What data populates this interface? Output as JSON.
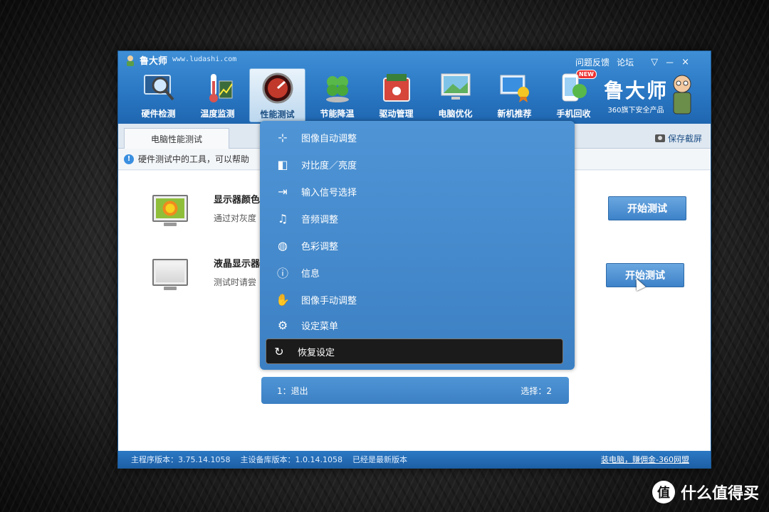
{
  "app": {
    "title": "鲁大师",
    "url": "www.ludashi.com",
    "top_links": [
      "问题反馈",
      "论坛"
    ],
    "window_controls": [
      "▽",
      "－",
      "×"
    ]
  },
  "toolbar": {
    "items": [
      {
        "label": "硬件检测",
        "icon": "magnifier-monitor-icon",
        "color": "#8fb8e0"
      },
      {
        "label": "温度监测",
        "icon": "thermometer-icon",
        "color": "#d9534f"
      },
      {
        "label": "性能测试",
        "icon": "speedometer-icon",
        "color": "#c0392b",
        "active": true
      },
      {
        "label": "节能降温",
        "icon": "clover-icon",
        "color": "#59b84a"
      },
      {
        "label": "驱动管理",
        "icon": "chip-box-icon",
        "color": "#d6463b"
      },
      {
        "label": "电脑优化",
        "icon": "monitor-landscape-icon",
        "color": "#5fb05f"
      },
      {
        "label": "新机推荐",
        "icon": "monitor-medal-icon",
        "color": "#3a8fe0"
      },
      {
        "label": "手机回收",
        "icon": "phone-recycle-icon",
        "color": "#59b84a",
        "badge": "NEW"
      }
    ]
  },
  "brand": {
    "name": "鲁大师",
    "subtitle": "360旗下安全产品"
  },
  "tabs": {
    "current": "电脑性能测试",
    "save_screenshot": "保存截屏"
  },
  "info_text": "硬件测试中的工具，可以帮助",
  "tests": [
    {
      "title": "显示器颜色",
      "desc": "通过对灰度",
      "button": "开始测试"
    },
    {
      "title": "液晶显示器",
      "desc": "测试时请尝",
      "button": "开始测试"
    }
  ],
  "status": {
    "main_version_label": "主程序版本：",
    "main_version": "3.75.14.1058",
    "db_version_label": "主设备库版本：",
    "db_version": "1.0.14.1058",
    "latest": "已经是最新版本",
    "promo_link": "装电脑，赚佣金-360网盟"
  },
  "osd": {
    "items": [
      {
        "label": "图像自动调整",
        "icon": "auto-adjust-icon"
      },
      {
        "label": "对比度／亮度",
        "icon": "contrast-icon"
      },
      {
        "label": "输入信号选择",
        "icon": "input-source-icon"
      },
      {
        "label": "音频调整",
        "icon": "audio-note-icon"
      },
      {
        "label": "色彩调整",
        "icon": "palette-icon"
      },
      {
        "label": "信息",
        "icon": "info-icon"
      },
      {
        "label": "图像手动调整",
        "icon": "manual-adjust-icon"
      },
      {
        "label": "设定菜单",
        "icon": "settings-gear-icon"
      },
      {
        "label": "恢复设定",
        "icon": "reset-icon",
        "selected": true
      }
    ],
    "footer_left": "1：退出",
    "footer_right": "选择：2"
  },
  "watermark": {
    "logo": "值",
    "text": "什么值得买"
  }
}
